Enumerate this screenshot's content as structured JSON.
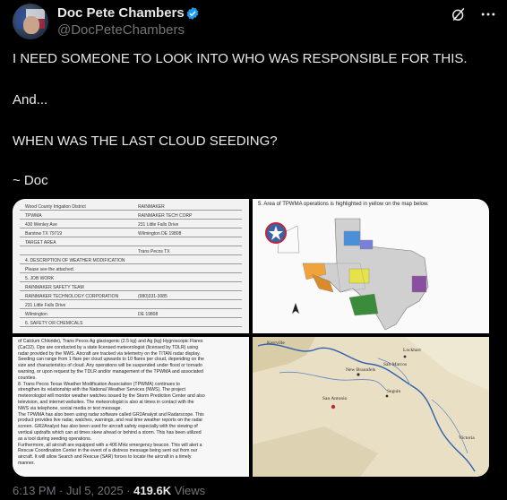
{
  "post": {
    "author_name": "Doc Pete Chambers",
    "handle": "@DocPeteChambers",
    "lines": [
      "I NEED SOMEONE TO LOOK INTO WHO WAS RESPONSIBLE FOR THIS.",
      "And...",
      "WHEN WAS THE LAST CLOUD SEEDING?",
      "~ Doc"
    ],
    "time": "6:13 PM",
    "sep1": " · ",
    "date": "Jul 5, 2025",
    "sep2": " · ",
    "views_count": "419.6K",
    "views_label": " Views"
  },
  "icons": {
    "verified": "verified-badge-icon",
    "grok": "grok-icon",
    "more": "more-icon"
  },
  "colors": {
    "verified": "#1d9bf0",
    "muted": "#71767b",
    "text": "#e7e9ea"
  },
  "media": {
    "form": {
      "rows": [
        [
          "Wood County Irrigation District",
          "RAINMAKER"
        ],
        [
          "TPWMA",
          "RAINMAKER TECH CORP"
        ],
        [
          "430 Wenley Ave",
          "231 Little Falls Drive"
        ],
        [
          "Barstow   TX   79719",
          "Wilmington   DE   19808"
        ],
        [
          "TARGET AREA",
          ""
        ],
        [
          "",
          "Trans Pecos TX"
        ],
        [
          "4. DESCRIPTION OF WEATHER MODIFICATION",
          ""
        ],
        [
          "Please see the attached.",
          ""
        ],
        [
          "5. JOB WORK",
          ""
        ],
        [
          "RAINMAKER SAFETY TEAM",
          ""
        ],
        [
          "RAINMAKER TECHNOLOGY CORPORATION",
          "(980)331-3085"
        ],
        [
          "231 Little Falls Drive",
          ""
        ],
        [
          "Wilmington",
          "DE   19808"
        ],
        [
          "6. SAFETY OR CHEMICALS",
          ""
        ]
      ]
    },
    "map_caption": "5.  Area of TPWMA operations is highlighted in yellow on the map below.",
    "doc_lines": [
      "of Calcium Chloride), Trans Pecos Ag glaciogenic (2.5 kg) and Ag (kg) Hygroscopic Flares",
      "(CaCl2). Ops are conducted by a state licensed meteorologist (licensed by TDLR) using",
      "radar provided by the NWS. Aircraft are tracked via telemetry on the TITAN radar display.",
      "Seeding can range from 1 flare per cloud upwards to 10 flares per cloud, depending on the",
      "size and characteristics of cloud. Any operations will be suspended under flood or tornado",
      "warning, or upon request by the TDLR and/or management of the TPWMA and associated",
      "counties.",
      "8. Trans Pecos Texas Weather Modification Association (TPWMA) continues to",
      "strengthen its relationship with the National Weather Services (NWS). The project",
      "meteorologist will monitor weather watches issued by the Storm Prediction Center and also",
      "television, and internet websites. The meteorologist is also at times in contact with the",
      "NWS via telephone, social media or text message.",
      "The TPWMA has also been using radar software called GR2Analyst and Radarscope. This",
      "product provides live radar, watches, warnings, and real time weather reports on the radar",
      "screen. GR2Analyst has also been used for aircraft safety especially with the viewing of",
      "vertical updrafts which can at times skew ahead or behind a storm. This has been utilized",
      "as a tool during seeding operations.",
      "Furthermore, all aircraft are equipped with a 406 MHz emergency beacon. This will alert a",
      "Rescue Coordination Center in the event of a distress message being sent out from our",
      "aircraft. It will allow Search and Rescue (SAR) forces to locate the aircraft in a timely",
      "manner."
    ],
    "river_map_labels": [
      "Kerrville",
      "Lockhart",
      "San Marcos",
      "New Braunfels",
      "Seguin",
      "San Antonio",
      "Victoria"
    ]
  }
}
